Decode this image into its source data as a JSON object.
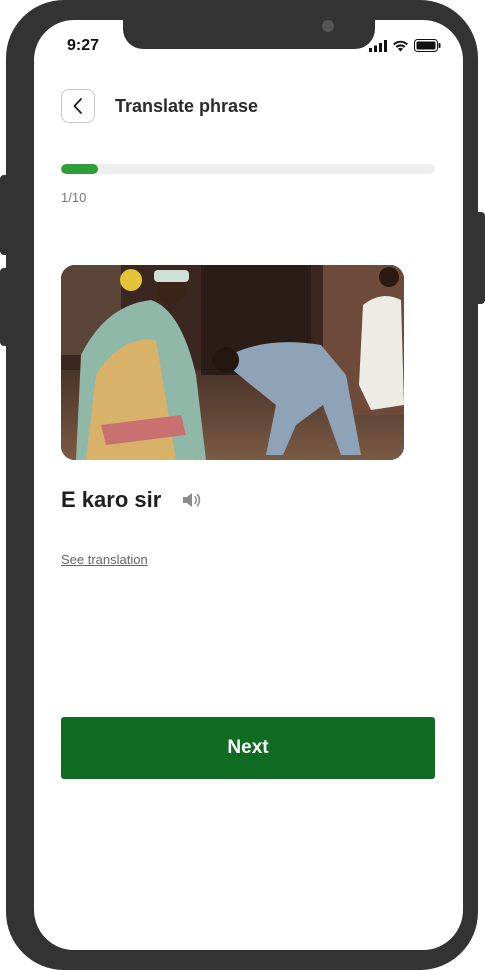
{
  "status_bar": {
    "time": "9:27",
    "icons": [
      "signal-icon",
      "wifi-icon",
      "battery-icon"
    ]
  },
  "header": {
    "back_icon": "chevron-left-icon",
    "title": "Translate phrase"
  },
  "progress": {
    "current": 1,
    "total": 10,
    "fraction": 0.1,
    "label": "1/10",
    "fill_color": "#2e9e3a"
  },
  "phrase": {
    "image_icon": "phrase-photo",
    "text": "E karo sir",
    "audio_icon": "speaker-icon"
  },
  "see_translation": "See translation",
  "next_button": {
    "label": "Next",
    "color": "#106b23"
  }
}
